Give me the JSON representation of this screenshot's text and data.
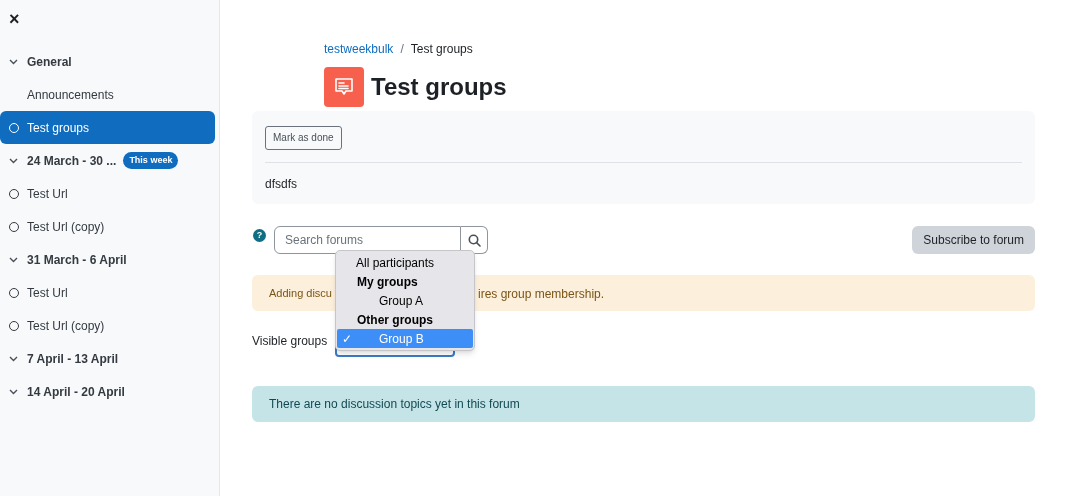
{
  "drawer": {
    "close": "×",
    "items": [
      {
        "kind": "section",
        "label": "General",
        "expanded": true
      },
      {
        "kind": "activity",
        "label": "Announcements",
        "tracked": false,
        "selected": false
      },
      {
        "kind": "activity",
        "label": "Test groups",
        "tracked": true,
        "selected": true
      },
      {
        "kind": "section",
        "label": "24 March - 30 ...",
        "expanded": true,
        "badge": "This week"
      },
      {
        "kind": "activity",
        "label": "Test Url",
        "tracked": true,
        "selected": false
      },
      {
        "kind": "activity",
        "label": "Test Url (copy)",
        "tracked": true,
        "selected": false
      },
      {
        "kind": "section",
        "label": "31 March - 6 April",
        "expanded": true
      },
      {
        "kind": "activity",
        "label": "Test Url",
        "tracked": true,
        "selected": false
      },
      {
        "kind": "activity",
        "label": "Test Url (copy)",
        "tracked": true,
        "selected": false
      },
      {
        "kind": "section",
        "label": "7 April - 13 April",
        "expanded": true
      },
      {
        "kind": "section",
        "label": "14 April - 20 April",
        "expanded": true
      }
    ]
  },
  "breadcrumb": [
    {
      "label": "testweekbulk",
      "link": true
    },
    {
      "label": "Test groups",
      "link": false
    }
  ],
  "breadcrumb_separator": "/",
  "title": "Test groups",
  "activity_card": {
    "button": "Mark as done",
    "description": "dfsdfs"
  },
  "help": "?",
  "search": {
    "placeholder": "Search forums"
  },
  "subscribe_button": "Subscribe to forum",
  "warning_alert": {
    "text_start": "Adding discu",
    "text_end": "ires group membership."
  },
  "group_select": {
    "label": "Visible groups",
    "options": [
      {
        "kind": "option",
        "label": "All participants",
        "selected": false
      },
      {
        "kind": "group",
        "label": "My groups"
      },
      {
        "kind": "suboption",
        "label": "Group A",
        "selected": false
      },
      {
        "kind": "group",
        "label": "Other groups"
      },
      {
        "kind": "suboption",
        "label": "Group B",
        "selected": true,
        "check": "✓"
      }
    ]
  },
  "info_alert": "There are no discussion topics yet in this forum"
}
